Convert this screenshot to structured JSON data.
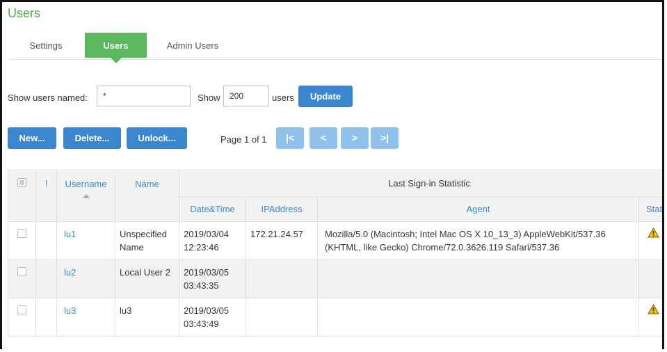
{
  "page": {
    "title": "Users"
  },
  "tabs": [
    {
      "label": "Settings",
      "active": false
    },
    {
      "label": "Users",
      "active": true
    },
    {
      "label": "Admin Users",
      "active": false
    }
  ],
  "filter": {
    "show_named_label": "Show users named:",
    "name_value": "*",
    "show_label": "Show",
    "count_value": "200",
    "users_label": "users",
    "update_label": "Update"
  },
  "actions": {
    "new_label": "New...",
    "delete_label": "Delete...",
    "unlock_label": "Unlock..."
  },
  "pager": {
    "page_text": "Page 1 of 1",
    "first": "|<",
    "prev": "<",
    "next": ">",
    "last": ">|"
  },
  "table": {
    "headers": {
      "bang": "!",
      "username": "Username",
      "name": "Name",
      "last_signin": "Last Sign-in Statistic",
      "datetime": "Date&Time",
      "ip": "IPAddress",
      "agent": "Agent",
      "status": "Status"
    },
    "rows": [
      {
        "username": "lu1",
        "name": "Unspecified Name",
        "datetime": "2019/03/04 12:23:46",
        "ip": "172.21.24.57",
        "agent": "Mozilla/5.0 (Macintosh; Intel Mac OS X 10_13_3) AppleWebKit/537.36 (KHTML, like Gecko) Chrome/72.0.3626.119 Safari/537.36",
        "status_icon": "warning-icon"
      },
      {
        "username": "lu2",
        "name": "Local User 2",
        "datetime": "2019/03/05 03:43:35",
        "ip": "",
        "agent": "",
        "status_icon": ""
      },
      {
        "username": "lu3",
        "name": "lu3",
        "datetime": "2019/03/05 03:43:49",
        "ip": "",
        "agent": "",
        "status_icon": "warning-icon"
      }
    ]
  },
  "colors": {
    "accent_green": "#5cb85c",
    "title_green": "#4cae4c",
    "button_blue": "#3a87cf",
    "pager_blue": "#8fc1ec",
    "link_blue": "#3a87cf",
    "warning_yellow": "#f0c400"
  }
}
